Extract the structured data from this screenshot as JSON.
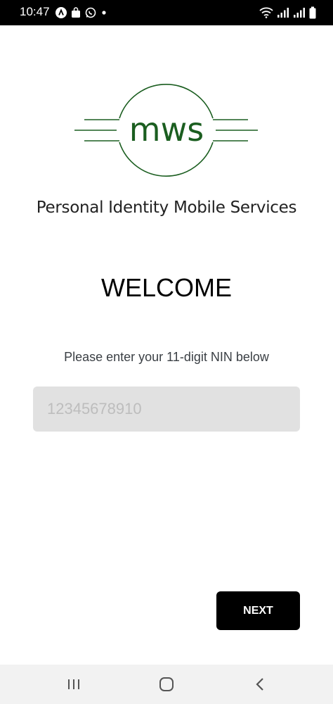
{
  "status_bar": {
    "time": "10:47",
    "left_icons": [
      "a-icon",
      "shopping-bag-icon",
      "whatsapp-icon",
      "dot-icon"
    ],
    "right_icons": [
      "wifi-icon",
      "signal-icon",
      "signal-icon",
      "battery-icon"
    ]
  },
  "logo": {
    "text": "mws",
    "color": "#1b5e20"
  },
  "tagline": "Personal Identity Mobile Services",
  "welcome": "WELCOME",
  "instruction": "Please enter your 11-digit NIN below",
  "nin_input": {
    "value": "",
    "placeholder": "12345678910"
  },
  "next_button": {
    "label": "NEXT"
  },
  "nav_bar": {
    "buttons": [
      "recent-apps-icon",
      "home-icon",
      "back-icon"
    ]
  }
}
